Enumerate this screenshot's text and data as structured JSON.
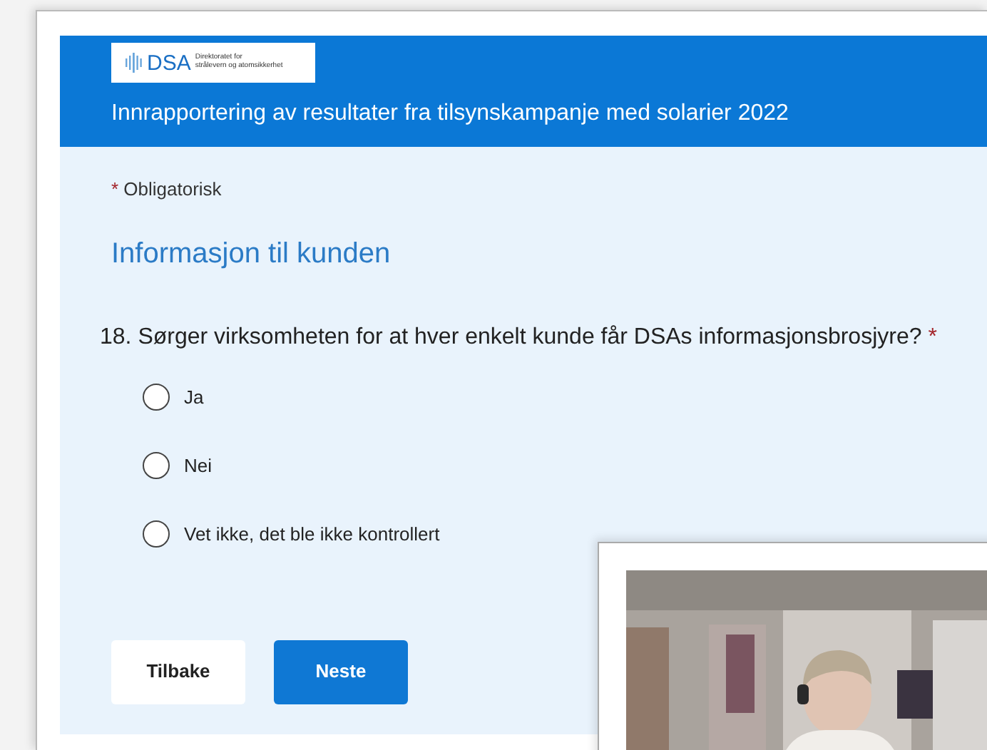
{
  "logo": {
    "abbr": "DSA",
    "line_1": "Direktoratet for",
    "line_2": "strålevern og atomsikkerhet"
  },
  "form_title": "Innrapportering av resultater fra tilsynskampanje med solarier 2022",
  "required_note": {
    "mark": "*",
    "text": "Obligatorisk"
  },
  "section_title": "Informasjon til kunden",
  "question": {
    "number": "18.",
    "text": "Sørger virksomheten for at hver enkelt kunde får DSAs informasjonsbrosjyre?",
    "required_mark": "*"
  },
  "options": [
    {
      "label": "Ja",
      "selected": false
    },
    {
      "label": "Nei",
      "selected": false
    },
    {
      "label": "Vet ikke, det ble ikke kontrollert",
      "selected": false
    }
  ],
  "buttons": [
    {
      "label": "Tilbake",
      "kind": "secondary"
    },
    {
      "label": "Neste",
      "kind": "primary"
    }
  ]
}
